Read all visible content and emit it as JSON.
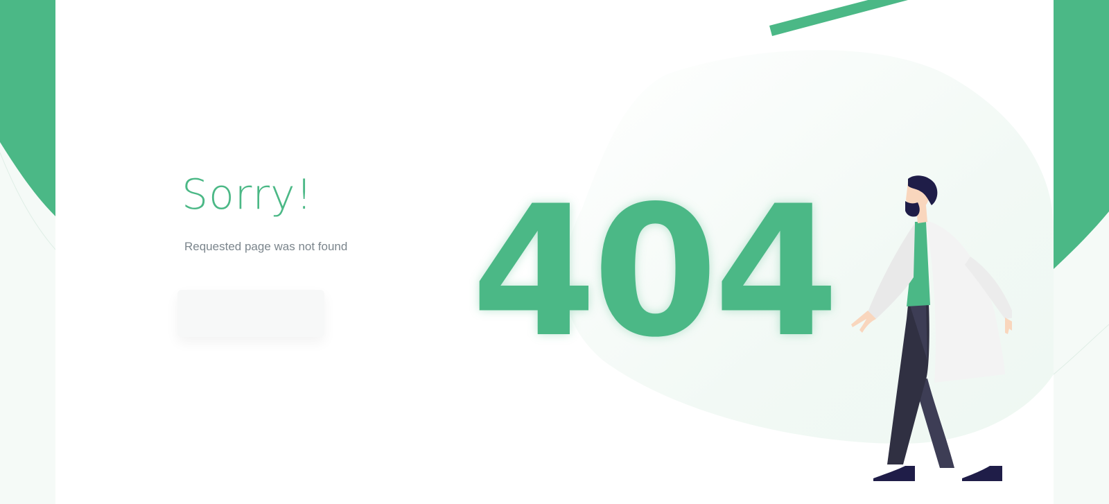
{
  "error_page": {
    "title": "Sorry!",
    "message": "Requested page was not found",
    "code": "404",
    "home_button_label": ""
  },
  "colors": {
    "accent": "#4bb886",
    "accent_soft": "#eef8f3",
    "text_muted": "#7b858c",
    "button_bg": "#f7f8f8",
    "skin": "#f9d6bd",
    "hair": "#1f1d48",
    "coat": "#f2f2f2",
    "pants": "#303042",
    "shoes": "#1f1d48"
  },
  "icons": {
    "illustration": "walking-man-icon"
  }
}
